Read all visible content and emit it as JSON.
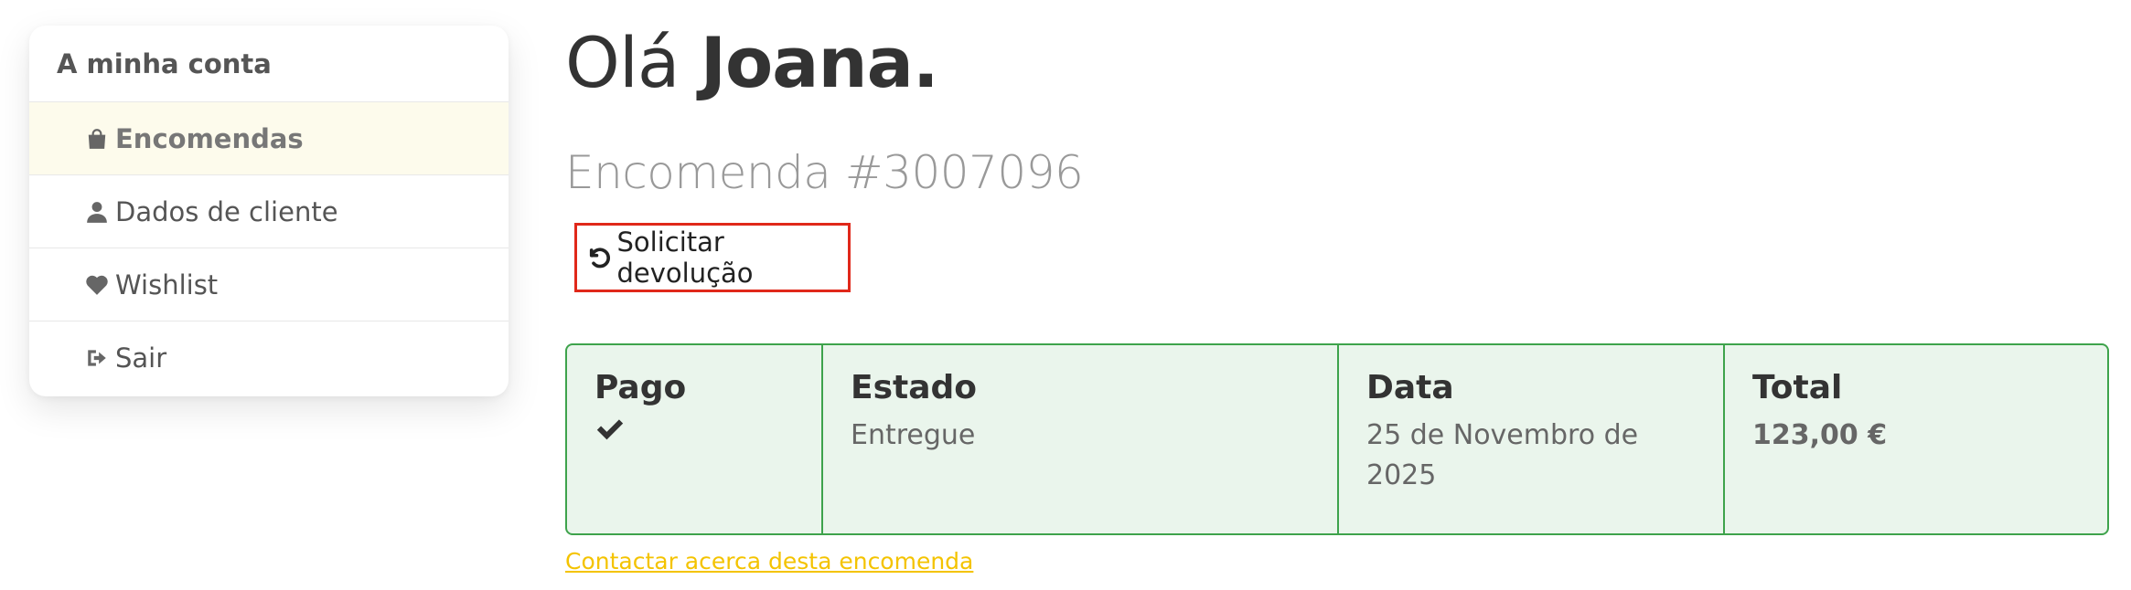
{
  "sidebar": {
    "title": "A minha conta",
    "items": [
      {
        "label": "Encomendas",
        "icon": "shopping-bag-icon",
        "active": true
      },
      {
        "label": "Dados de cliente",
        "icon": "user-icon",
        "active": false
      },
      {
        "label": "Wishlist",
        "icon": "heart-icon",
        "active": false
      },
      {
        "label": "Sair",
        "icon": "sign-out-icon",
        "active": false
      }
    ]
  },
  "main": {
    "greeting_prefix": "Olá",
    "greeting_name": "Joana.",
    "order_title": "Encomenda #3007096",
    "return_button": {
      "label": "Solicitar devolução",
      "icon": "undo-icon"
    },
    "info": {
      "paid_label": "Pago",
      "paid_icon": "check-icon",
      "state_label": "Estado",
      "state_value": "Entregue",
      "date_label": "Data",
      "date_value": "25 de Novembro de 2025",
      "total_label": "Total",
      "total_value": "123,00 €"
    },
    "contact_link": "Contactar acerca desta encomenda"
  },
  "colors": {
    "accent_yellow": "#f4c300",
    "highlight_red": "#e0281a",
    "success_green": "#3ea34c",
    "success_bg": "#eaf5ec",
    "active_item_bg": "#fdfbec"
  }
}
